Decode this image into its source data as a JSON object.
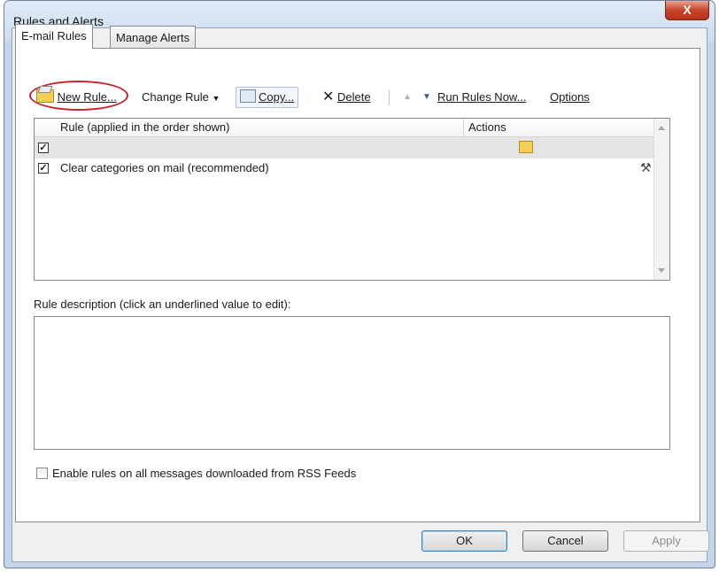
{
  "window": {
    "title": "Rules and Alerts",
    "close_glyph": "X"
  },
  "tabs": [
    {
      "label": "E-mail Rules"
    },
    {
      "label": "Manage Alerts"
    }
  ],
  "toolbar": {
    "new_rule": "New Rule...",
    "change_rule": "Change Rule",
    "copy": "Copy...",
    "delete": "Delete",
    "run_rules_now": "Run Rules Now...",
    "options": "Options"
  },
  "rules_list": {
    "col_rule": "Rule (applied in the order shown)",
    "col_actions": "Actions",
    "rows": [
      {
        "name": "",
        "checked": true,
        "selected": true,
        "action_icon": "folder-move-icon"
      },
      {
        "name": "Clear categories on mail (recommended)",
        "checked": true,
        "selected": false,
        "action_icon": "tools-icon"
      }
    ]
  },
  "description": {
    "label": "Rule description (click an underlined value to edit):",
    "text": ""
  },
  "rss": {
    "label": "Enable rules on all messages downloaded from RSS Feeds",
    "checked": false
  },
  "buttons": {
    "ok": "OK",
    "cancel": "Cancel",
    "apply": "Apply"
  },
  "colors": {
    "highlight": "#c0262c",
    "frame": "#c4d5ea",
    "close": "#c7462c"
  }
}
